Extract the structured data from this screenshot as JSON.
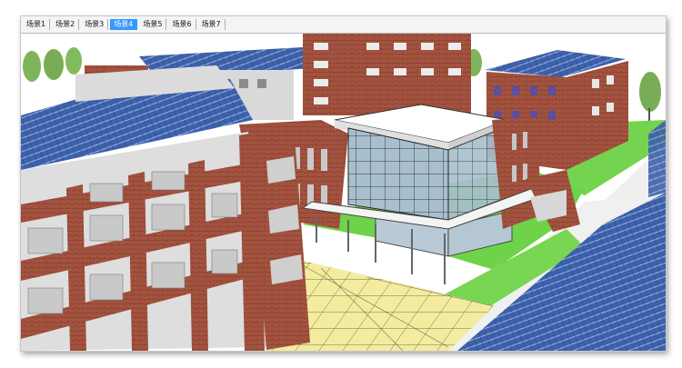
{
  "tabs": [
    {
      "label": "场景1",
      "active": false
    },
    {
      "label": "场景2",
      "active": false
    },
    {
      "label": "场景3",
      "active": false
    },
    {
      "label": "场景4",
      "active": true
    },
    {
      "label": "场景5",
      "active": false
    },
    {
      "label": "场景6",
      "active": false
    },
    {
      "label": "场景7",
      "active": false
    }
  ],
  "colors": {
    "brick": "#a0513e",
    "roof_blue": "#3a5fa8",
    "glass": "#9fb7c8",
    "grass": "#6fd34a",
    "paving": "#f2eb9c",
    "tab_active": "#3399ff"
  }
}
